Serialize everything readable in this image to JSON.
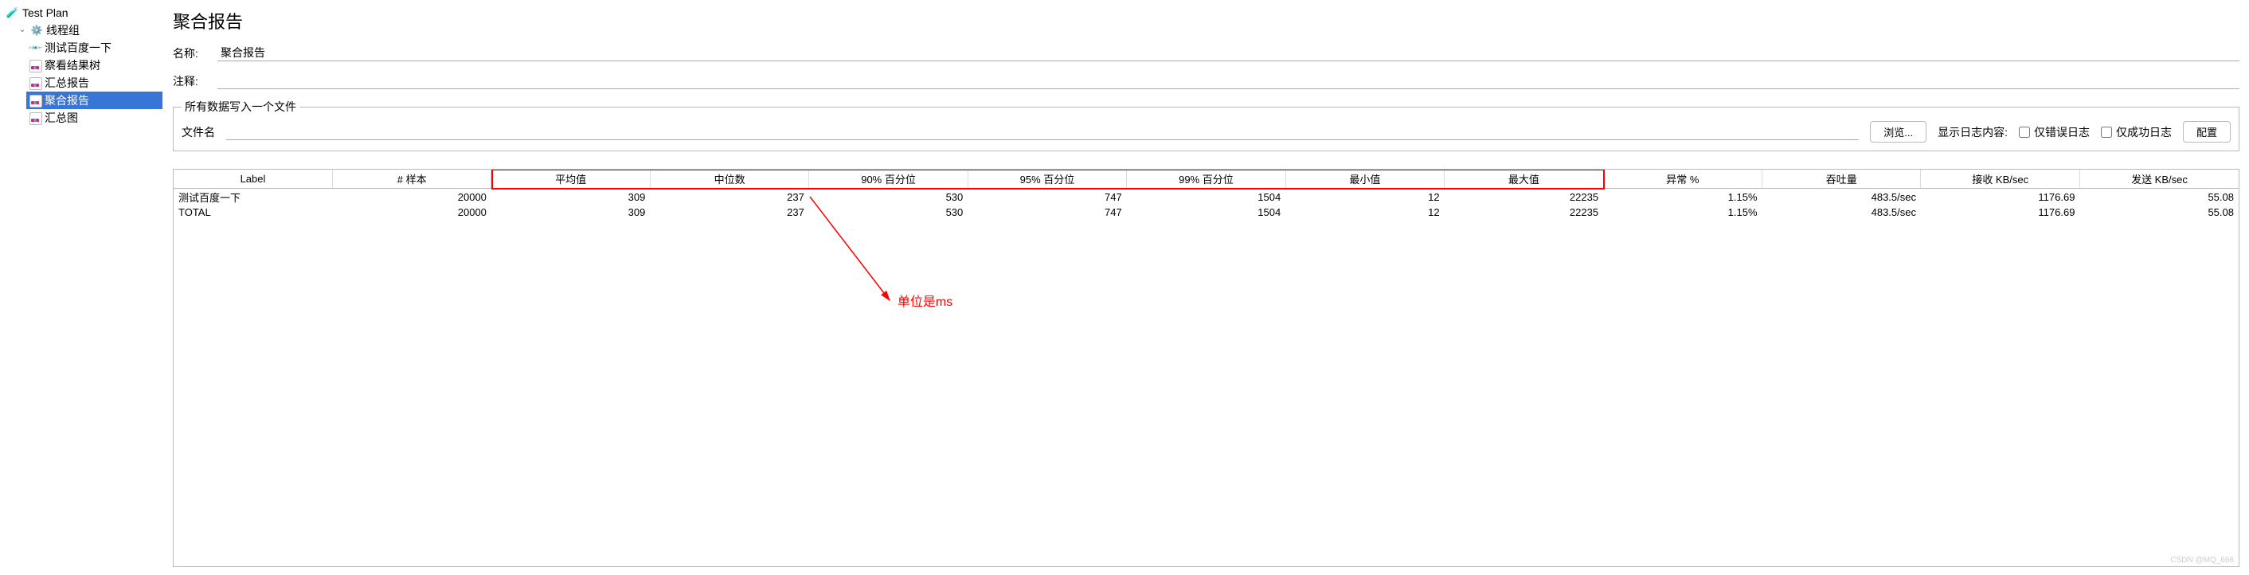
{
  "tree": {
    "root": "Test Plan",
    "thread_group": "线程组",
    "items": [
      "测试百度一下",
      "察看结果树",
      "汇总报告",
      "聚合报告",
      "汇总图"
    ],
    "selected_index": 3
  },
  "page": {
    "title": "聚合报告",
    "name_label": "名称:",
    "name_value": "聚合报告",
    "comment_label": "注释:",
    "comment_value": ""
  },
  "file_box": {
    "legend": "所有数据写入一个文件",
    "filename_label": "文件名",
    "filename_value": "",
    "browse": "浏览...",
    "log_display_label": "显示日志内容:",
    "error_only": "仅错误日志",
    "success_only": "仅成功日志",
    "configure": "配置"
  },
  "table": {
    "headers": [
      "Label",
      "# 样本",
      "平均值",
      "中位数",
      "90% 百分位",
      "95% 百分位",
      "99% 百分位",
      "最小值",
      "最大值",
      "异常 %",
      "吞吐量",
      "接收 KB/sec",
      "发送 KB/sec"
    ],
    "rows": [
      {
        "cells": [
          "测试百度一下",
          "20000",
          "309",
          "237",
          "530",
          "747",
          "1504",
          "12",
          "22235",
          "1.15%",
          "483.5/sec",
          "1176.69",
          "55.08"
        ]
      },
      {
        "cells": [
          "TOTAL",
          "20000",
          "309",
          "237",
          "530",
          "747",
          "1504",
          "12",
          "22235",
          "1.15%",
          "483.5/sec",
          "1176.69",
          "55.08"
        ]
      }
    ]
  },
  "annotation": {
    "text": "单位是ms"
  },
  "watermark": "CSDN @MQ_666"
}
